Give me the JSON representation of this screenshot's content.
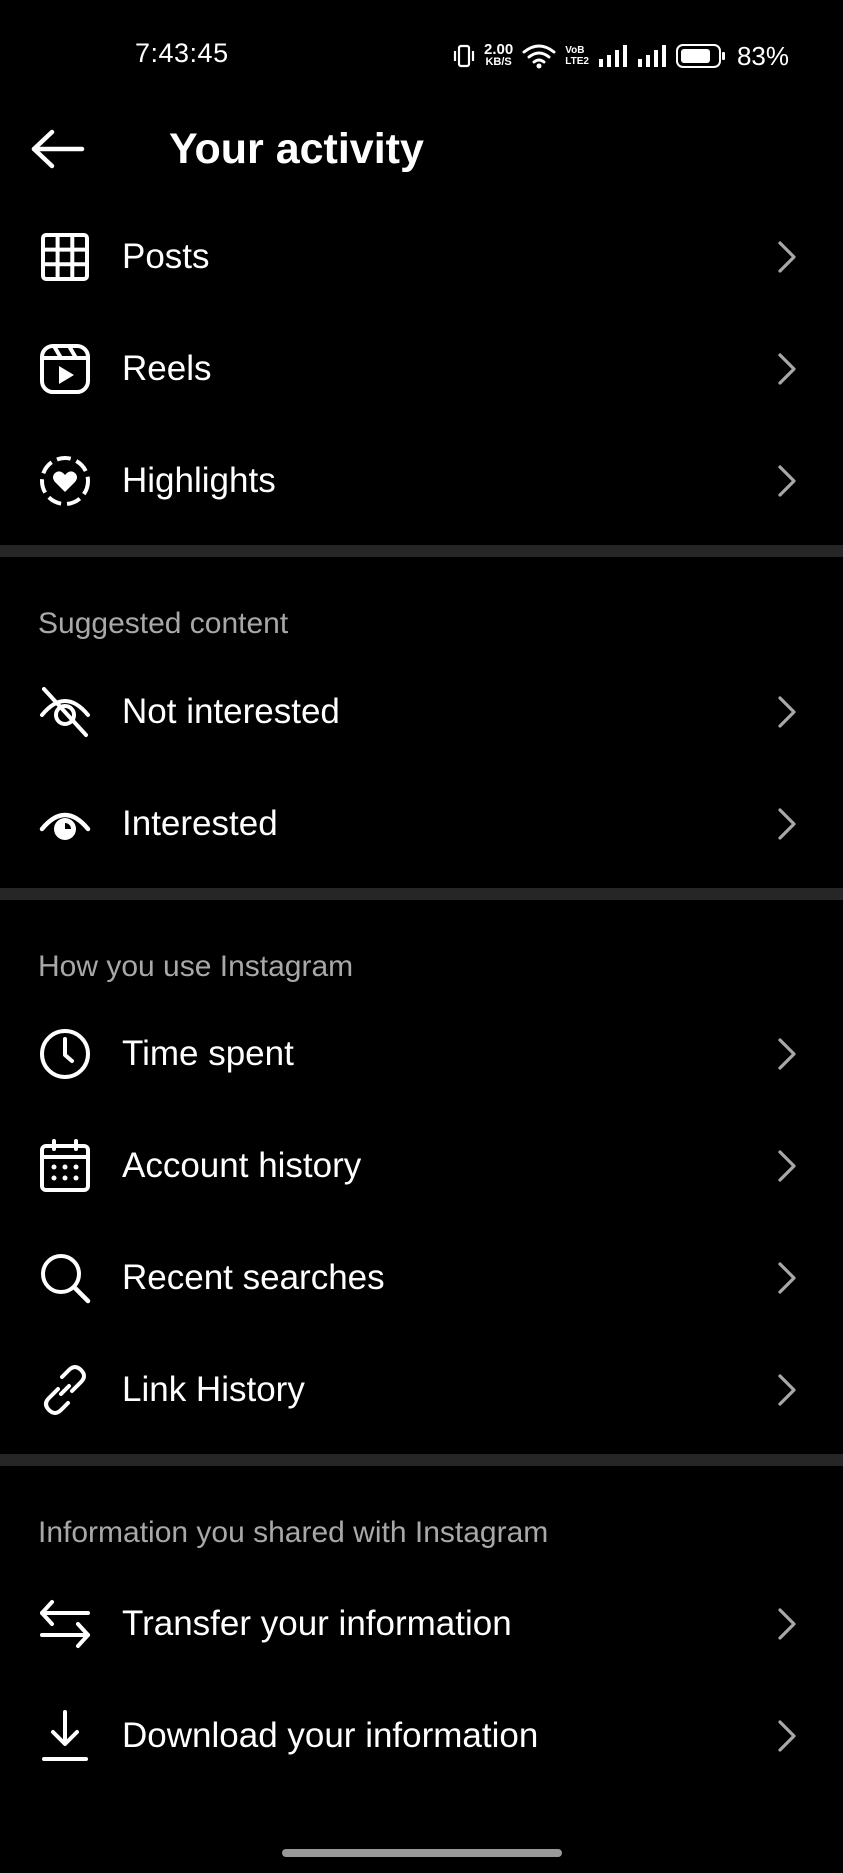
{
  "status_bar": {
    "time": "7:43:45",
    "net_speed_value": "2.00",
    "net_speed_unit": "KB/S",
    "volte_top": "VoB",
    "volte_bottom": "LTE2",
    "battery_percent": "83%",
    "battery_level": 0.83,
    "icons": [
      "vibrate-icon",
      "wifi-icon",
      "signal-icon",
      "signal-icon",
      "battery-icon"
    ]
  },
  "header": {
    "title": "Your activity",
    "back_icon": "arrow-left-icon"
  },
  "sections": {
    "top_items": [
      {
        "label": "Posts",
        "icon": "grid-icon"
      },
      {
        "label": "Reels",
        "icon": "reels-icon"
      },
      {
        "label": "Highlights",
        "icon": "highlights-icon"
      }
    ],
    "suggested": {
      "title": "Suggested content",
      "items": [
        {
          "label": "Not interested",
          "icon": "eye-slash-icon"
        },
        {
          "label": "Interested",
          "icon": "eye-icon"
        }
      ]
    },
    "usage": {
      "title": "How you use Instagram",
      "items": [
        {
          "label": "Time spent",
          "icon": "clock-icon"
        },
        {
          "label": "Account history",
          "icon": "calendar-icon"
        },
        {
          "label": "Recent searches",
          "icon": "search-icon"
        },
        {
          "label": "Link History",
          "icon": "link-icon"
        }
      ]
    },
    "shared": {
      "title": "Information you shared with Instagram",
      "items": [
        {
          "label": "Transfer your information",
          "icon": "transfer-icon"
        },
        {
          "label": "Download your information",
          "icon": "download-icon"
        }
      ]
    }
  },
  "colors": {
    "background": "#000000",
    "text": "#ffffff",
    "section_title": "#a8a8a8",
    "divider": "#262626",
    "chevron": "#a8a8a8"
  }
}
